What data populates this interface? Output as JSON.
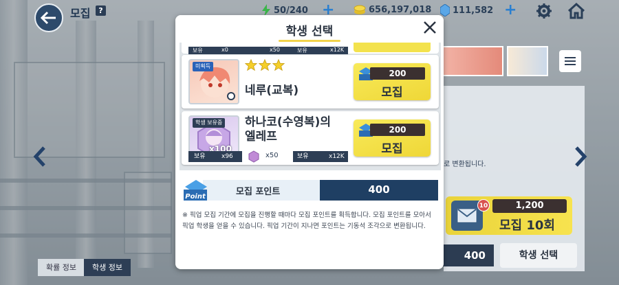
{
  "topbar": {
    "title": "모집",
    "help": "?",
    "ap": "50/240",
    "credits": "656,197,018",
    "pyroxene": "111,582"
  },
  "background": {
    "panel_text": "로 변환됩니다.",
    "recruit10": {
      "mail_count": "10",
      "cost": "1,200",
      "label": "모집 10회"
    },
    "points": "400",
    "select_button": "학생 선택",
    "tabs": [
      "확률 정보",
      "학생 정보"
    ]
  },
  "modal": {
    "title": "학생 선택",
    "top_stub": {
      "owned_label": "보유",
      "owned_value": "x0",
      "frag": "x50",
      "owned2_label": "보유",
      "owned2_value": "x12K"
    },
    "students": [
      {
        "badge": "미획득",
        "stars": 3,
        "name": "네루(교복)",
        "recruit_cost": "200",
        "recruit_label": "모집"
      },
      {
        "badge": "학생 보유중",
        "name_line1": "하나코(수영복)의",
        "name_line2": "엘레프",
        "count": "x100",
        "owned_label": "보유",
        "owned_value": "x96",
        "frag": "x50",
        "owned2_label": "보유",
        "owned2_value": "x12K",
        "recruit_cost": "200",
        "recruit_label": "모집"
      }
    ],
    "points_label": "모집 포인트",
    "points_value": "400",
    "point_logo": "Point",
    "notice": "※ 픽업 모집 기간에 모집을 진행할 때마다 모집 포인트를 획득합니다. 모집 포인트를 모아서 픽업 학생을 얻을 수 있습니다. 픽업 기간이 지나면 포인트는 기동석 조각으로 변환됩니다."
  },
  "colors": {
    "accent_yellow": "#f2d34a",
    "navy": "#2d3e55",
    "point_blue": "#2a7fd0"
  }
}
